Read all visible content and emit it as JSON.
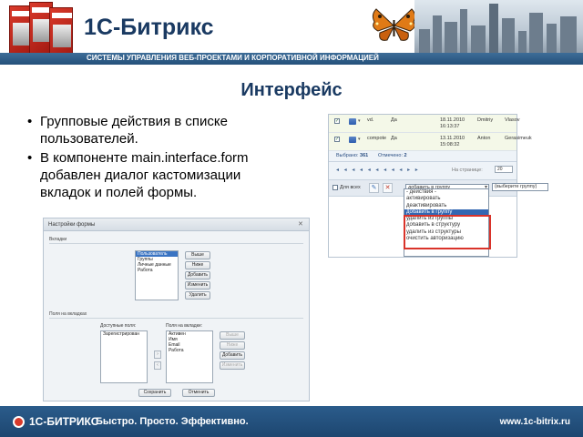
{
  "header": {
    "logo": "1С-Битрикс",
    "tagline": "СИСТЕМЫ УПРАВЛЕНИЯ ВЕБ-ПРОЕКТАМИ И КОРПОРАТИВНОЙ ИНФОРМАЦИЕЙ"
  },
  "slide_title": "Интерфейс",
  "bullets": [
    "Групповые действия в списке пользователей.",
    "В компоненте main.interface.form добавлен диалог кастомизации вкладок и полей формы."
  ],
  "form_dialog": {
    "title": "Настройки формы",
    "tabs_section": "Вкладки",
    "tabs_list": [
      "Пользователь",
      "Группы",
      "Личные данные",
      "Работа"
    ],
    "tab_buttons": [
      "Выше",
      "Ниже",
      "Добавить",
      "Изменить",
      "Удалить"
    ],
    "fields_section": "Поля на вкладках",
    "available_label": "Доступные поля:",
    "available_list": [
      "Зарегистрирован"
    ],
    "tab_fields_label": "Поля на вкладке:",
    "tab_fields_list": [
      "Активен",
      "Имя",
      "Email",
      "Работа"
    ],
    "field_buttons": [
      "Выше",
      "Ниже",
      "Добавить",
      "Изменить"
    ],
    "save_label": "Сохранить",
    "cancel_label": "Отменить"
  },
  "user_list": {
    "rows": [
      {
        "login": "vd.",
        "active": "Да",
        "date": "18.11.2010 16:13:37",
        "name": "Dmitriy",
        "last_name": "Vlasov"
      },
      {
        "login": "compote",
        "active": "Да",
        "date": "13.11.2010 15:08:32",
        "name": "Anton",
        "last_name": "Gerasimeuk"
      }
    ],
    "selected_label": "Выбрано:",
    "selected_count": "361",
    "marked_label": "Отмечено:",
    "marked_count": "2",
    "per_page_label": "На странице:",
    "per_page_value": "20",
    "for_all_label": "Для всех",
    "group_action_value": "добавить в группу",
    "group_select_value": "(выберите группу)",
    "action_options": [
      "- действия -",
      "активировать",
      "деактивировать",
      "добавить в группу",
      "удалить из группы",
      "добавить в структуру",
      "удалить из структуры",
      "очистить авторизацию"
    ],
    "selected_option_index": 3
  },
  "footer": {
    "logo": "1С-БИТРИКС",
    "slogan": "Быстро. Просто. Эффективно.",
    "url": "www.1c-bitrix.ru"
  },
  "colors": {
    "brand_blue": "#1a3a62",
    "bar_blue": "#2b5c8b",
    "highlight_red": "#d9332a",
    "selection_blue": "#3367b2"
  }
}
